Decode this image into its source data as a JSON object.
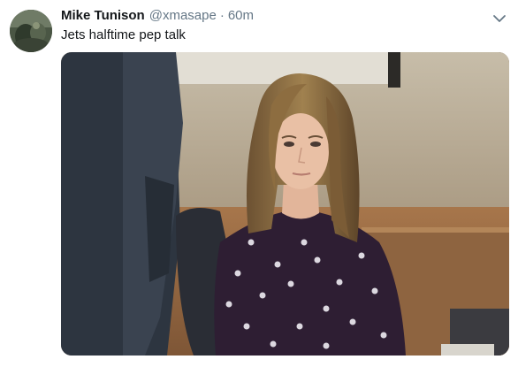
{
  "tweet": {
    "display_name": "Mike Tunison",
    "handle": "@xmasape",
    "separator": "·",
    "time": "60m",
    "text": "Jets halftime pep talk"
  },
  "icons": {
    "avatar": "user-avatar-photo",
    "menu": "chevron-down-icon"
  },
  "colors": {
    "name": "#14171a",
    "secondary": "#657786",
    "background": "#ffffff"
  }
}
